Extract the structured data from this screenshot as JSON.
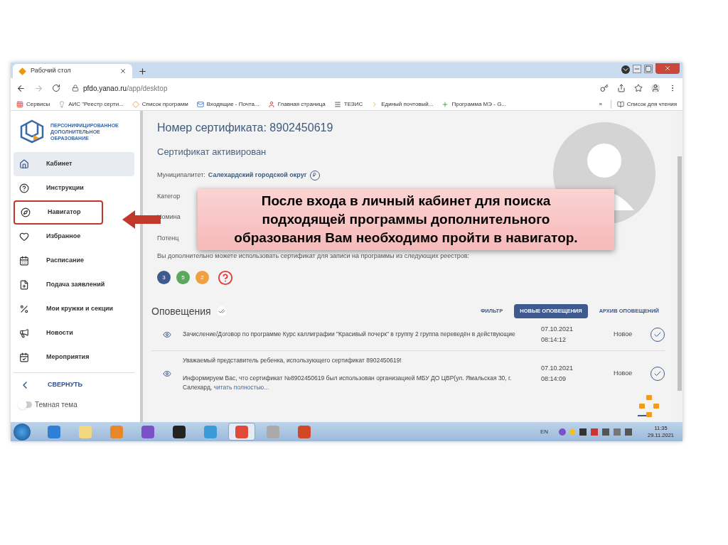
{
  "browser": {
    "tab_title": "Рабочий стол",
    "url_host": "pfdo.yanao.ru",
    "url_path": "/app/desktop",
    "bookmarks": [
      {
        "kind": "apps",
        "label": "Сервисы"
      },
      {
        "kind": "bulb",
        "label": "АИС \"Реестр серти..."
      },
      {
        "kind": "diamond",
        "label": "Список программ"
      },
      {
        "kind": "mail",
        "label": "Входящие - Почта..."
      },
      {
        "kind": "person",
        "label": "Главная страница"
      },
      {
        "kind": "menu",
        "label": "ТЕЗИС"
      },
      {
        "kind": "play",
        "label": "Единый почтовый..."
      },
      {
        "kind": "plus",
        "label": "Программа МЭ - G..."
      }
    ],
    "more": "»",
    "reading_list": "Список для чтения"
  },
  "sidebar": {
    "logo_text": "ПЕРСОНИФИЦИРОВАННОЕ ДОПОЛНИТЕЛЬНОЕ ОБРАЗОВАНИЕ",
    "items": [
      {
        "kind": "home",
        "label": "Кабинет",
        "selected": true,
        "annotated": false
      },
      {
        "kind": "help",
        "label": "Инструкции",
        "selected": false,
        "annotated": false
      },
      {
        "kind": "compass",
        "label": "Навигатор",
        "selected": false,
        "annotated": true
      },
      {
        "kind": "heart",
        "label": "Избранное",
        "selected": false,
        "annotated": false
      },
      {
        "kind": "calendar",
        "label": "Расписание",
        "selected": false,
        "annotated": false
      },
      {
        "kind": "file",
        "label": "Подача заявлений",
        "selected": false,
        "annotated": false
      },
      {
        "kind": "math",
        "label": "Мои кружки и секции",
        "selected": false,
        "annotated": false
      },
      {
        "kind": "news",
        "label": "Новости",
        "selected": false,
        "annotated": false
      },
      {
        "kind": "event",
        "label": "Мероприятия",
        "selected": false,
        "annotated": false
      }
    ],
    "collapse": "СВЕРНУТЬ",
    "dark_theme": {
      "label": "Темная тема",
      "on": false
    }
  },
  "certificate": {
    "title": "Номер сертификата: 8902450619",
    "status": "Сертификат активирован",
    "municipality_label": "Муниципалитет:",
    "municipality": "Салехардский городской округ",
    "currency_sign": "₽",
    "partial_labels": [
      "Категор",
      "Номина",
      "Потенц"
    ],
    "registries_text": "Вы дополнительно можете использовать сертификат для записи на программы из следующих реестров:",
    "registries": [
      {
        "label": "3",
        "color": "#3f5a8f"
      },
      {
        "label": "5",
        "color": "#5aa85a"
      },
      {
        "label": "2",
        "color": "#f0a040"
      }
    ]
  },
  "callout": {
    "text": "После входа в личный кабинет для поиска подходящей программы дополнительного образования Вам необходимо пройти в навигатор."
  },
  "notifications": {
    "title": "Оповещения",
    "tabs": [
      {
        "label": "ФИЛЬТР",
        "selected": false
      },
      {
        "label": "НОВЫЕ ОПОВЕЩЕНИЯ",
        "selected": true
      },
      {
        "label": "АРХИВ ОПОВЕЩЕНИЙ",
        "selected": false
      }
    ],
    "rows": [
      {
        "lines": [
          "Зачисление/Договор по программе Курс каллиграфии \"Красивый почерк\" в группу 2 группа переведён в действующие"
        ],
        "link": "",
        "date": "07.10.2021",
        "time": "08:14:12",
        "status": "Новое"
      },
      {
        "lines": [
          "Уважаемый представитель ребенка, использующего сертификат 8902450619!",
          "Информируем Вас, что сертификат №8902450619 был использован организацией МБУ ДО ЦВР(ул. Ямальская 30, г. Салехард,"
        ],
        "link": "читать полностью...",
        "date": "07.10.2021",
        "time": "08:14:09",
        "status": "Новое"
      }
    ]
  },
  "taskbar": {
    "apps": [
      {
        "kind": "ie",
        "selected": false
      },
      {
        "kind": "folder",
        "selected": false
      },
      {
        "kind": "media",
        "selected": false
      },
      {
        "kind": "viber",
        "selected": false
      },
      {
        "kind": "v",
        "selected": false
      },
      {
        "kind": "people",
        "selected": false
      },
      {
        "kind": "chrome",
        "selected": true
      },
      {
        "kind": "printer",
        "selected": false
      },
      {
        "kind": "ppt",
        "selected": false
      }
    ],
    "language": "EN",
    "time": "11:35",
    "date": "29.11.2021"
  }
}
